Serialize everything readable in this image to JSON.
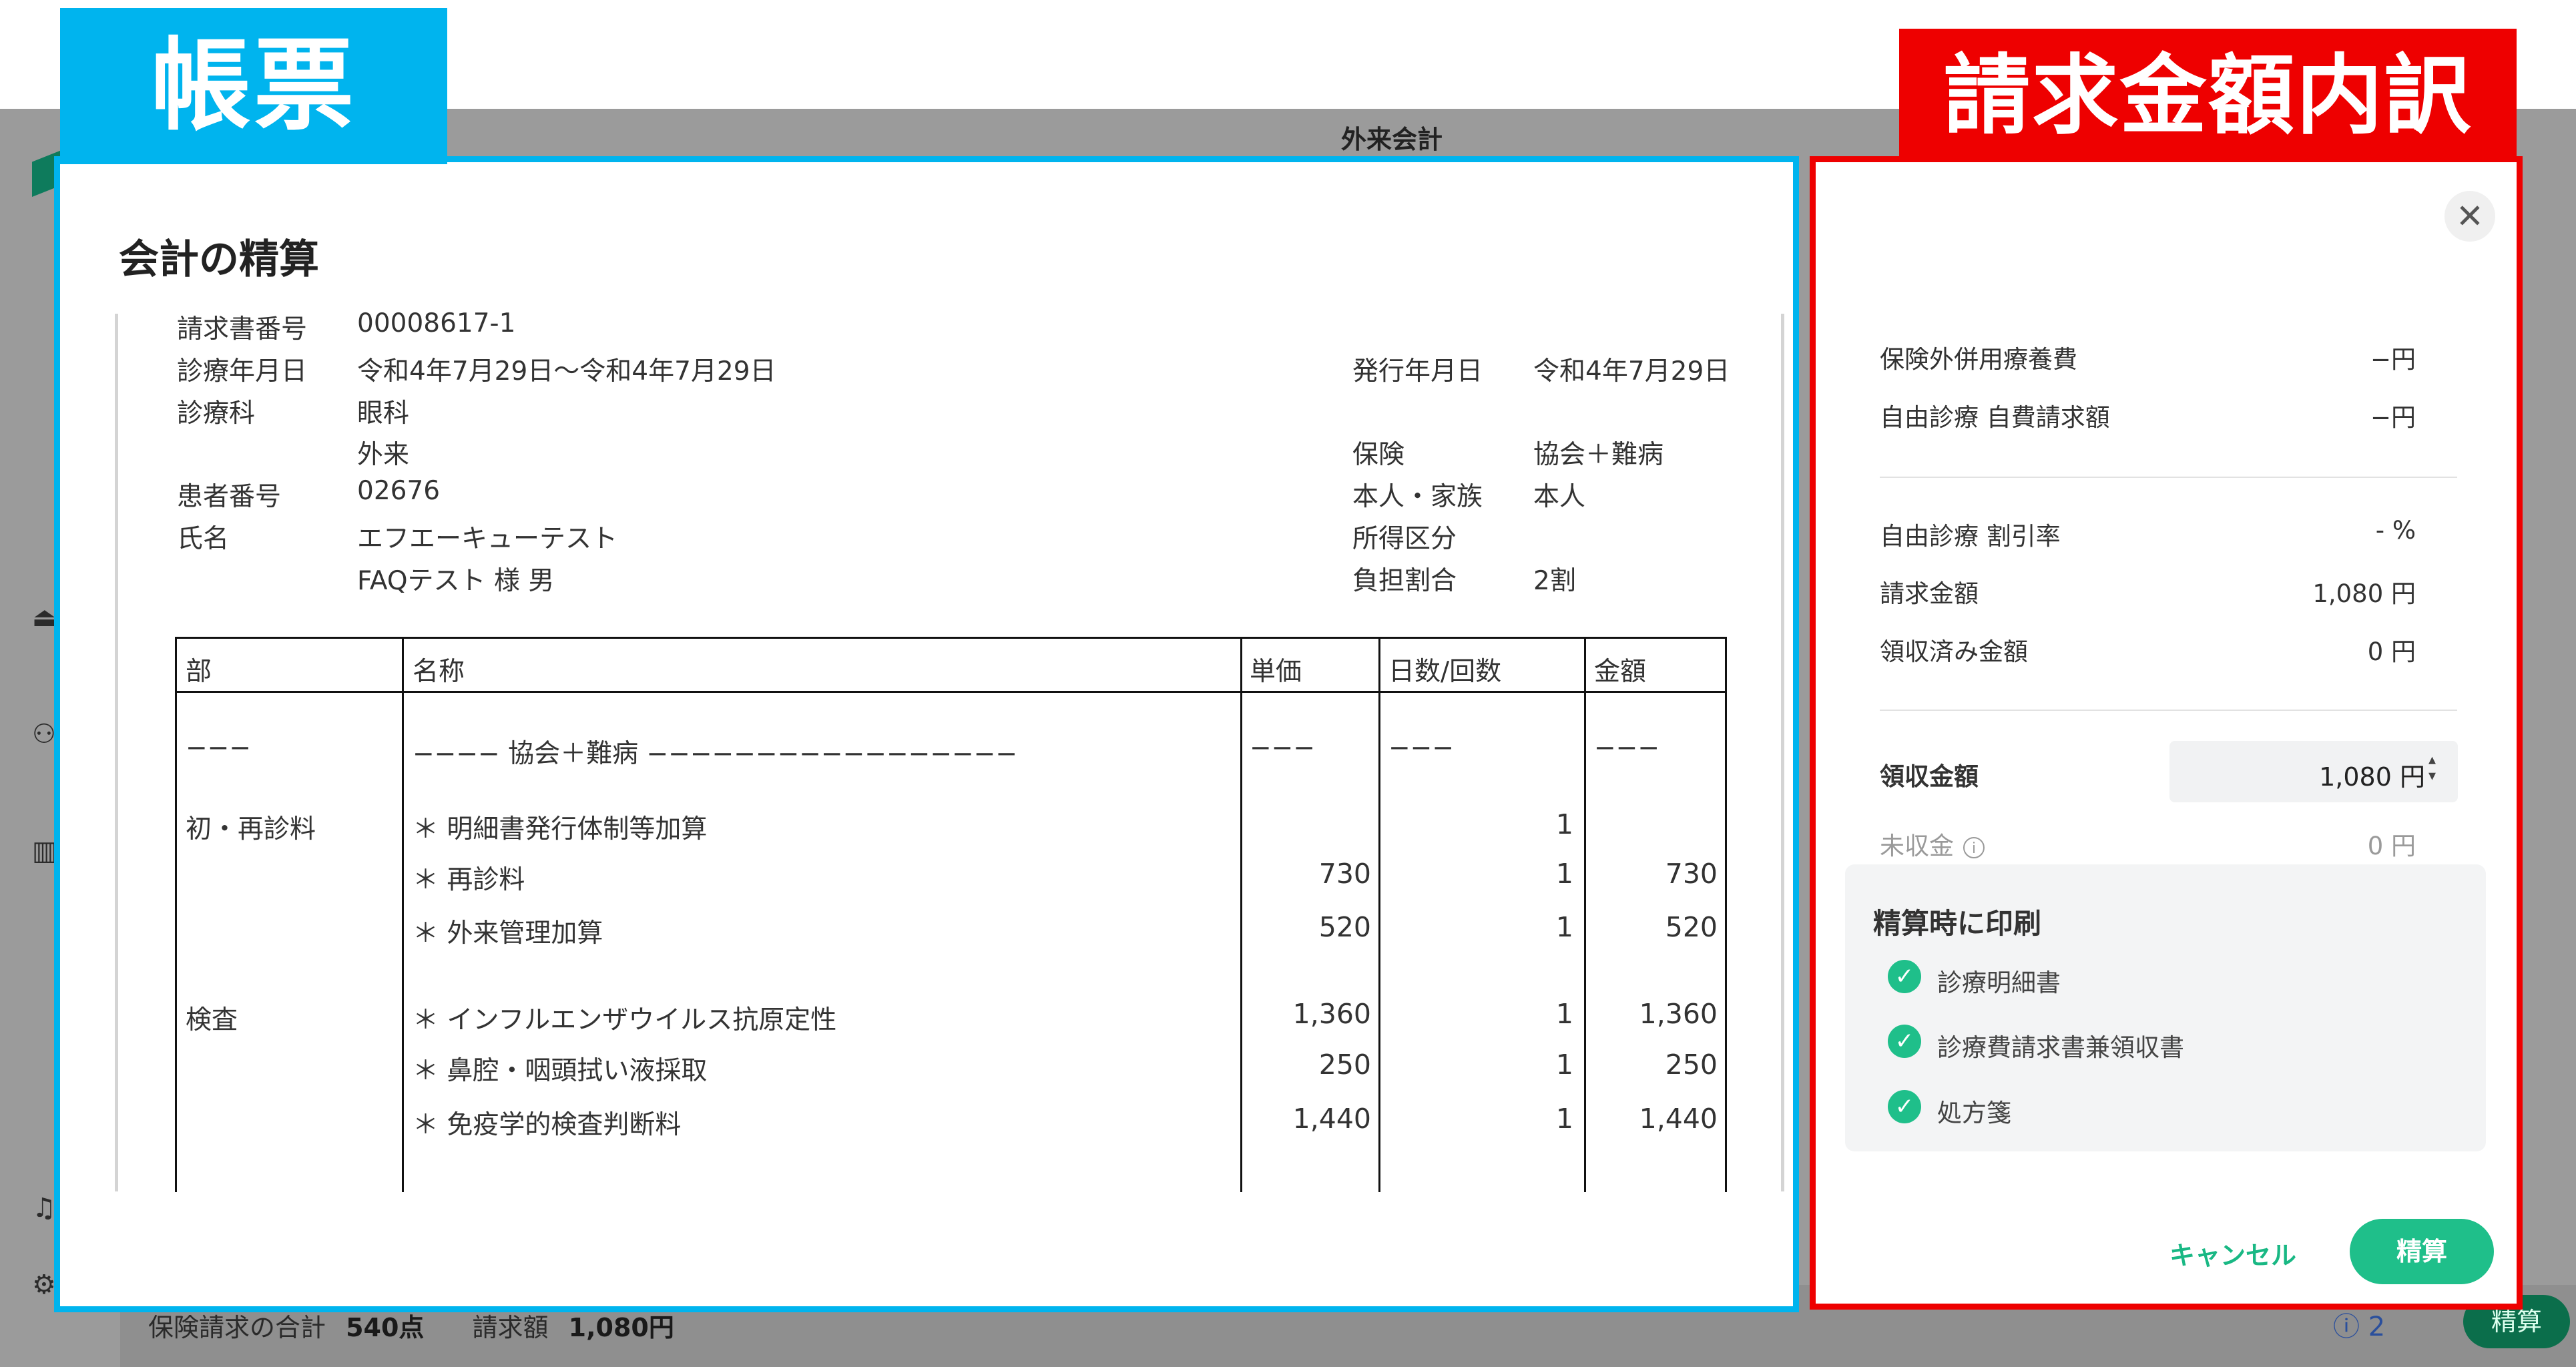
{
  "window_title": "外来会計",
  "labels": {
    "document": "帳票",
    "billing": "請求金額内訳"
  },
  "footer": {
    "insurance_total_label": "保険請求の合計",
    "insurance_total_value": "540点",
    "billed_label": "請求額",
    "billed_value": "1,080円",
    "info_count": "2",
    "settle_button": "精算"
  },
  "document": {
    "title": "会計の精算",
    "invoice_no_label": "請求書番号",
    "invoice_no": "00008617-1",
    "treatment_date_label": "診療年月日",
    "treatment_date": "令和4年7月29日〜令和4年7月29日",
    "issue_date_label": "発行年月日",
    "issue_date": "令和4年7月29日",
    "department_label": "診療科",
    "department": "眼科",
    "visit_type": "外来",
    "insurance_label": "保険",
    "insurance": "協会＋難病",
    "patient_no_label": "患者番号",
    "patient_no": "02676",
    "relation_label": "本人・家族",
    "relation": "本人",
    "name_label": "氏名",
    "name": "エフエーキューテスト",
    "income_label": "所得区分",
    "name_alpha": "FAQテスト 様 男",
    "burden_label": "負担割合",
    "burden": "2割",
    "table": {
      "headers": [
        "部",
        "名称",
        "単価",
        "日数/回数",
        "金額"
      ],
      "dash_row": [
        "−−−",
        "−−−− 協会＋難病 −−−−−−−−−−−−−−−−−",
        "−−−",
        "−−−",
        "−−−"
      ],
      "rows": [
        {
          "section": "初・再診料",
          "name": "＊ 明細書発行体制等加算",
          "unit": "",
          "count": "1",
          "amount": ""
        },
        {
          "section": "",
          "name": "＊ 再診料",
          "unit": "730",
          "count": "1",
          "amount": "730"
        },
        {
          "section": "",
          "name": "＊ 外来管理加算",
          "unit": "520",
          "count": "1",
          "amount": "520"
        },
        {
          "section": "検査",
          "name": "＊ インフルエンザウイルス抗原定性",
          "unit": "1,360",
          "count": "1",
          "amount": "1,360"
        },
        {
          "section": "",
          "name": "＊ 鼻腔・咽頭拭い液採取",
          "unit": "250",
          "count": "1",
          "amount": "250"
        },
        {
          "section": "",
          "name": "＊ 免疫学的検査判断料",
          "unit": "1,440",
          "count": "1",
          "amount": "1,440"
        }
      ]
    }
  },
  "billing": {
    "rows_top": [
      {
        "label": "保険外併用療養費",
        "value": "−円"
      },
      {
        "label": "自由診療 自費請求額",
        "value": "−円"
      }
    ],
    "rows_mid": [
      {
        "label": "自由診療 割引率",
        "value": "- %"
      },
      {
        "label": "請求金額",
        "value": "1,080 円"
      },
      {
        "label": "領収済み金額",
        "value": "0 円"
      }
    ],
    "receipt_label": "領収金額",
    "receipt_value": "1,080 円",
    "unpaid_label": "未収金",
    "unpaid_value": "0 円",
    "print_title": "精算時に印刷",
    "print_options": [
      "診療明細書",
      "診療費請求書兼領収書",
      "処方箋"
    ],
    "cancel": "キャンセル",
    "settle": "精算"
  },
  "colors": {
    "blue_frame": "#00b4ee",
    "red_frame": "#ee0000",
    "accent_green": "#1fbf8a"
  }
}
